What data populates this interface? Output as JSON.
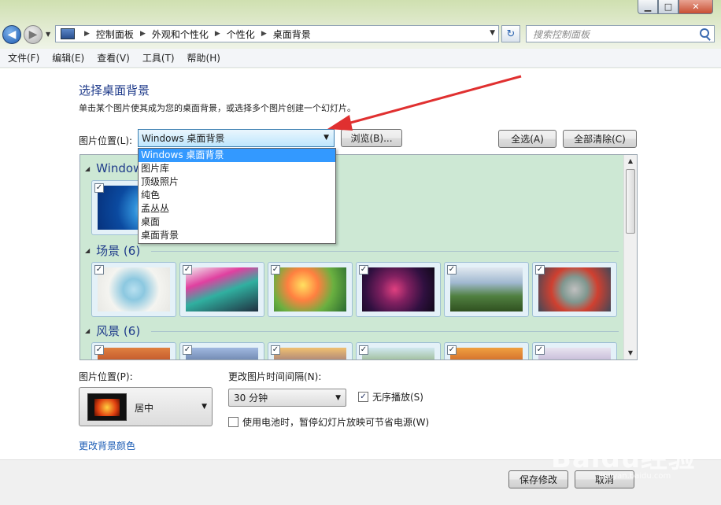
{
  "address": {
    "crumbs": [
      "控制面板",
      "外观和个性化",
      "个性化",
      "桌面背景"
    ],
    "search_placeholder": "搜索控制面板"
  },
  "menu": [
    "文件(F)",
    "编辑(E)",
    "查看(V)",
    "工具(T)",
    "帮助(H)"
  ],
  "page": {
    "heading": "选择桌面背景",
    "description": "单击某个图片使其成为您的桌面背景，或选择多个图片创建一个幻灯片。",
    "location_label": "图片位置(L):",
    "location_value": "Windows 桌面背景",
    "browse_button": "浏览(B)...",
    "select_all_button": "全选(A)",
    "clear_all_button": "全部清除(C)"
  },
  "dropdown_options": [
    "Windows 桌面背景",
    "图片库",
    "顶级照片",
    "纯色",
    "孟丛丛",
    "桌面",
    "桌面背景"
  ],
  "gallery": {
    "group1_title": "Windows",
    "group2_title": "场景 (6)",
    "group3_title": "风景 (6)"
  },
  "bottom": {
    "position_label": "图片位置(P):",
    "position_value": "居中",
    "interval_label": "更改图片时间间隔(N):",
    "interval_value": "30 分钟",
    "shuffle_label": "无序播放(S)",
    "battery_label": "使用电池时，暂停幻灯片放映可节省电源(W)",
    "change_color_link": "更改背景颜色"
  },
  "footer": {
    "save_button": "保存修改",
    "cancel_button": "取消"
  },
  "watermark": {
    "brand": "Baidu经验",
    "url": "jingyan.baidu.com"
  },
  "colors": {
    "accent": "#1e3a8a",
    "selection": "#3399ff",
    "annotation_arrow": "#e03030"
  }
}
